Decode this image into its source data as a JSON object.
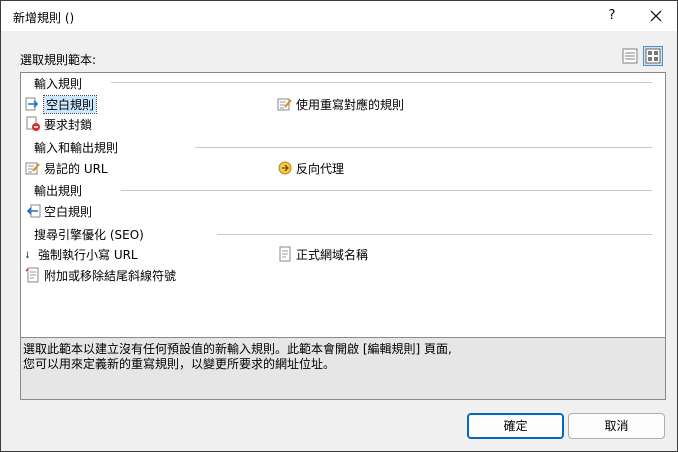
{
  "dialog": {
    "title": "新增規則 ()",
    "help_glyph": "?",
    "close_glyph": "✕"
  },
  "section_label": "選取規則範本:",
  "view_buttons": [
    {
      "icon": "list-view-icon"
    },
    {
      "icon": "tile-view-icon"
    }
  ],
  "groups": [
    {
      "header": "輸入規則",
      "items": [
        {
          "label": "空白規則",
          "icon": "arrow-right-icon",
          "selected": true
        },
        {
          "label": "使用重寫對應的規則",
          "icon": "edit-map-icon"
        },
        {
          "label": "要求封鎖",
          "icon": "block-icon"
        }
      ]
    },
    {
      "header": "輸入和輸出規則",
      "items": [
        {
          "label": "易記的 URL",
          "icon": "edit-pencil-icon"
        },
        {
          "label": "反向代理",
          "icon": "proxy-icon"
        }
      ]
    },
    {
      "header": "輸出規則",
      "items": [
        {
          "label": "空白規則",
          "icon": "arrow-left-icon"
        }
      ]
    },
    {
      "header": "搜尋引擎優化 (SEO)",
      "items": [
        {
          "label": "強制執行小寫 URL",
          "icon": "lowercase-icon"
        },
        {
          "label": "正式網域名稱",
          "icon": "document-icon"
        },
        {
          "label": "附加或移除結尾斜線符號",
          "icon": "slash-doc-icon"
        }
      ]
    }
  ],
  "description": {
    "line1": "選取此範本以建立沒有任何預設值的新輸入規則。此範本會開啟 [編輯規則] 頁面,",
    "line2": "您可以用來定義新的重寫規則，以變更所要求的網址位址。"
  },
  "buttons": {
    "ok": "確定",
    "cancel": "取消"
  }
}
